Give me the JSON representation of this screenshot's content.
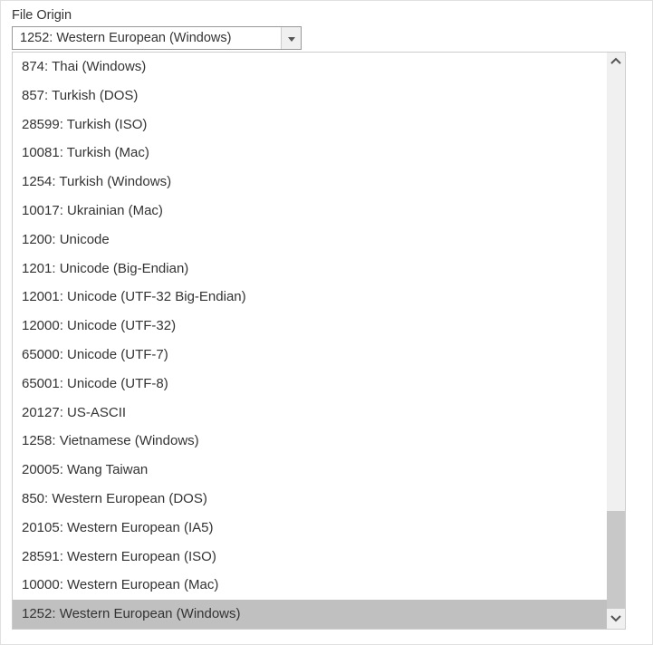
{
  "field": {
    "label": "File Origin",
    "selected": "1252: Western European (Windows)"
  },
  "options": [
    "874: Thai (Windows)",
    "857: Turkish (DOS)",
    "28599: Turkish (ISO)",
    "10081: Turkish (Mac)",
    "1254: Turkish (Windows)",
    "10017: Ukrainian (Mac)",
    "1200: Unicode",
    "1201: Unicode (Big-Endian)",
    "12001: Unicode (UTF-32 Big-Endian)",
    "12000: Unicode (UTF-32)",
    "65000: Unicode (UTF-7)",
    "65001: Unicode (UTF-8)",
    "20127: US-ASCII",
    "1258: Vietnamese (Windows)",
    "20005: Wang Taiwan",
    "850: Western European (DOS)",
    "20105: Western European (IA5)",
    "28591: Western European (ISO)",
    "10000: Western European (Mac)",
    "1252: Western European (Windows)"
  ],
  "selectedIndex": 19,
  "scrollbar": {
    "thumbTop": 484,
    "thumbHeight": 108
  }
}
